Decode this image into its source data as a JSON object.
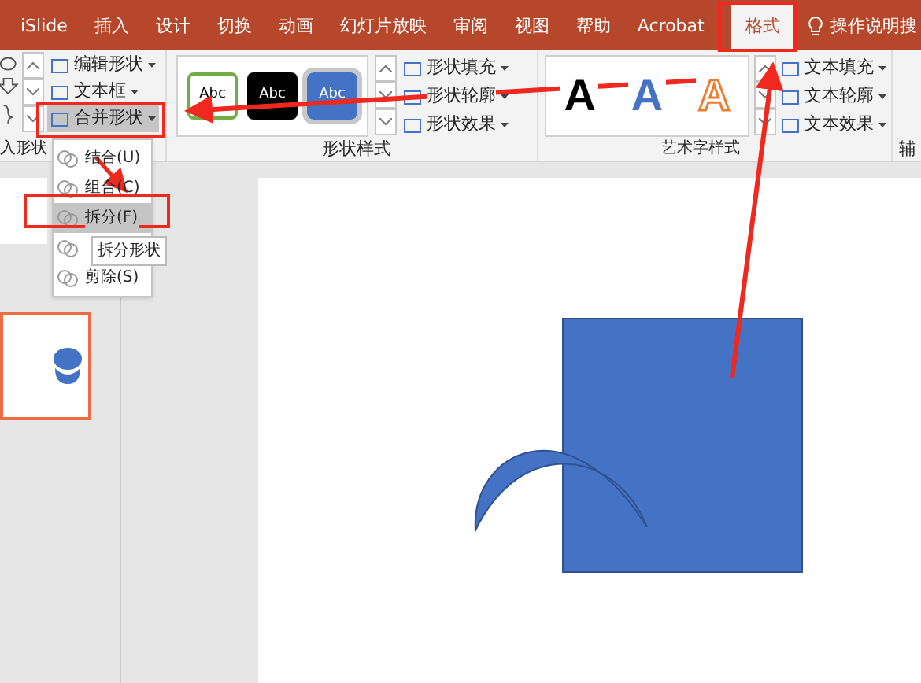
{
  "tabs": [
    {
      "label": "iSlide",
      "selected": false
    },
    {
      "label": "插入",
      "selected": false
    },
    {
      "label": "设计",
      "selected": false
    },
    {
      "label": "切换",
      "selected": false
    },
    {
      "label": "动画",
      "selected": false
    },
    {
      "label": "幻灯片放映",
      "selected": false
    },
    {
      "label": "审阅",
      "selected": false
    },
    {
      "label": "视图",
      "selected": false
    },
    {
      "label": "帮助",
      "selected": false
    },
    {
      "label": "Acrobat",
      "selected": false
    },
    {
      "label": "格式",
      "selected": true
    }
  ],
  "tell_me": {
    "text": "操作说明搜"
  },
  "ribbon": {
    "insert_shapes": {
      "label": "入形状"
    },
    "shape_commands": [
      {
        "label": "编辑形状",
        "selected": false
      },
      {
        "label": "文本框",
        "selected": false
      },
      {
        "label": "合并形状",
        "selected": true
      }
    ],
    "shape_styles": {
      "label": "形状样式",
      "swatches": [
        {
          "text": "Abc",
          "kind": "outline",
          "selected": false
        },
        {
          "text": "Abc",
          "kind": "dark",
          "selected": false
        },
        {
          "text": "Abc",
          "kind": "blue",
          "selected": true
        }
      ],
      "commands": [
        "形状填充",
        "形状轮廓",
        "形状效果"
      ]
    },
    "wordart_styles": {
      "label": "艺术字样式",
      "samples": [
        {
          "text": "A",
          "kind": "black"
        },
        {
          "text": "A",
          "kind": "blue"
        },
        {
          "text": "A",
          "kind": "orange"
        }
      ],
      "commands": [
        "文本填充",
        "文本轮廓",
        "文本效果"
      ]
    },
    "next_group": {
      "label": "辅"
    }
  },
  "merge_menu": {
    "items": [
      {
        "label": "结合(U)",
        "selected": false
      },
      {
        "label": "组合(C)",
        "selected": false
      },
      {
        "label": "拆分(F)",
        "selected": true
      },
      {
        "selected": false
      },
      {
        "label": "剪除(S)",
        "selected": false
      }
    ]
  },
  "tooltip": {
    "text": "拆分形状"
  }
}
